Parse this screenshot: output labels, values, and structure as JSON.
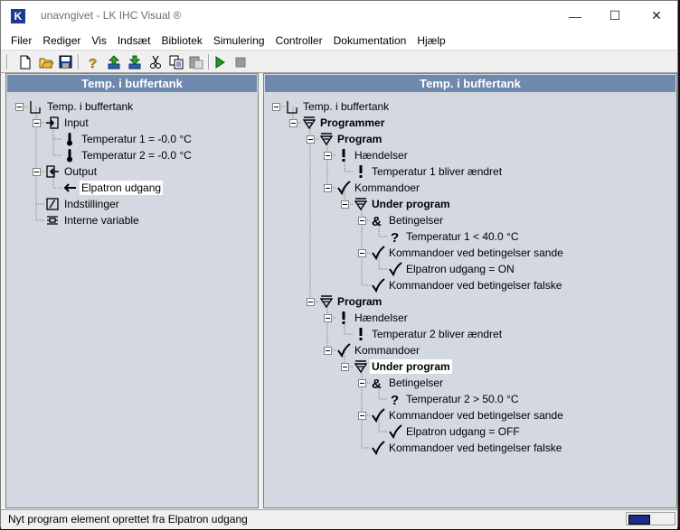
{
  "window": {
    "title": "unavngivet - LK IHC Visual ®",
    "app_icon_letter": "K",
    "minimize": "—",
    "maximize": "☐",
    "close": "✕"
  },
  "menu": [
    "Filer",
    "Rediger",
    "Vis",
    "Indsæt",
    "Bibliotek",
    "Simulering",
    "Controller",
    "Dokumentation",
    "Hjælp"
  ],
  "toolbar": [
    "new-icon",
    "open-icon",
    "save-icon",
    "help-icon",
    "upload-icon",
    "download-icon",
    "cut-icon",
    "copy-icon",
    "paste-icon",
    "run-icon",
    "stop-icon"
  ],
  "left_panel": {
    "header": "Temp. i buffertank",
    "nodes": [
      {
        "label": "Temp. i buffertank",
        "icon": "module-icon",
        "level": 0,
        "expander": true,
        "bold": false
      },
      {
        "label": "Input",
        "icon": "input-icon",
        "level": 1,
        "expander": true,
        "bold": false
      },
      {
        "label": "Temperatur 1 = -0.0 °C",
        "icon": "thermometer-icon",
        "level": 2,
        "expander": false,
        "bold": false
      },
      {
        "label": "Temperatur 2 = -0.0 °C",
        "icon": "thermometer-icon",
        "level": 2,
        "expander": false,
        "bold": false
      },
      {
        "label": "Output",
        "icon": "output-icon",
        "level": 1,
        "expander": true,
        "bold": false
      },
      {
        "label": "Elpatron udgang",
        "icon": "arrow-left-icon",
        "level": 2,
        "expander": false,
        "bold": false,
        "selected": true
      },
      {
        "label": "Indstillinger",
        "icon": "settings-icon",
        "level": 1,
        "expander": false,
        "bold": false
      },
      {
        "label": "Interne variable",
        "icon": "variables-icon",
        "level": 1,
        "expander": false,
        "bold": false
      }
    ]
  },
  "right_panel": {
    "header": "Temp. i buffertank",
    "nodes": [
      {
        "label": "Temp. i buffertank",
        "icon": "module-icon",
        "level": 0,
        "expander": true,
        "bold": false
      },
      {
        "label": "Programmer",
        "icon": "programs-icon",
        "level": 1,
        "expander": true,
        "bold": true
      },
      {
        "label": "Program",
        "icon": "program-icon",
        "level": 2,
        "expander": true,
        "bold": true
      },
      {
        "label": "Hændelser",
        "icon": "event-icon",
        "level": 3,
        "expander": true,
        "bold": false
      },
      {
        "label": "Temperatur 1 bliver ændret",
        "icon": "event-icon",
        "level": 4,
        "expander": false,
        "bold": false
      },
      {
        "label": "Kommandoer",
        "icon": "check-icon",
        "level": 3,
        "expander": true,
        "bold": false
      },
      {
        "label": "Under program",
        "icon": "program-icon",
        "level": 4,
        "expander": true,
        "bold": true
      },
      {
        "label": "Betingelser",
        "icon": "and-icon",
        "level": 5,
        "expander": true,
        "bold": false
      },
      {
        "label": "Temperatur 1 < 40.0 °C",
        "icon": "question-icon",
        "level": 6,
        "expander": false,
        "bold": false
      },
      {
        "label": "Kommandoer ved betingelser sande",
        "icon": "check-icon",
        "level": 5,
        "expander": true,
        "bold": false
      },
      {
        "label": "Elpatron udgang = ON",
        "icon": "check-icon",
        "level": 6,
        "expander": false,
        "bold": false
      },
      {
        "label": "Kommandoer ved betingelser falske",
        "icon": "check-icon",
        "level": 5,
        "expander": false,
        "bold": false
      },
      {
        "label": "Program",
        "icon": "program-icon",
        "level": 2,
        "expander": true,
        "bold": true
      },
      {
        "label": "Hændelser",
        "icon": "event-icon",
        "level": 3,
        "expander": true,
        "bold": false
      },
      {
        "label": "Temperatur 2 bliver ændret",
        "icon": "event-icon",
        "level": 4,
        "expander": false,
        "bold": false
      },
      {
        "label": "Kommandoer",
        "icon": "check-icon",
        "level": 3,
        "expander": true,
        "bold": false
      },
      {
        "label": "Under program",
        "icon": "program-icon",
        "level": 4,
        "expander": true,
        "bold": true,
        "selected": true
      },
      {
        "label": "Betingelser",
        "icon": "and-icon",
        "level": 5,
        "expander": true,
        "bold": false
      },
      {
        "label": "Temperatur 2 > 50.0 °C",
        "icon": "question-icon",
        "level": 6,
        "expander": false,
        "bold": false
      },
      {
        "label": "Kommandoer ved betingelser sande",
        "icon": "check-icon",
        "level": 5,
        "expander": true,
        "bold": false
      },
      {
        "label": "Elpatron udgang = OFF",
        "icon": "check-icon",
        "level": 6,
        "expander": false,
        "bold": false
      },
      {
        "label": "Kommandoer ved betingelser falske",
        "icon": "check-icon",
        "level": 5,
        "expander": false,
        "bold": false
      }
    ]
  },
  "status": {
    "text": "Nyt program element oprettet fra Elpatron udgang",
    "indicator_icon": "keyboard-icon"
  }
}
